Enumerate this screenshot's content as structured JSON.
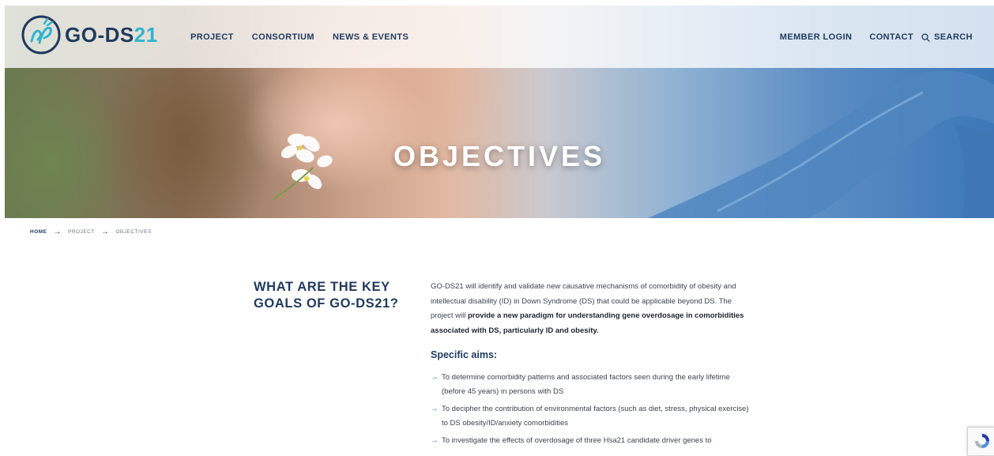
{
  "header": {
    "logo_text_main": "GO-DS",
    "logo_text_num": "21",
    "nav_left": [
      "PROJECT",
      "CONSORTIUM",
      "NEWS & EVENTS"
    ],
    "nav_right": [
      "MEMBER LOGIN",
      "CONTACT"
    ],
    "search_label": "SEARCH"
  },
  "hero": {
    "title": "OBJECTIVES"
  },
  "breadcrumb": {
    "home": "HOME",
    "project": "PROJECT",
    "current": "OBJECTIVES"
  },
  "content": {
    "heading": "WHAT ARE THE KEY GOALS OF GO-DS21?",
    "intro_plain": "GO-DS21 will identify and validate new causative mechanisms of comorbidity of obesity and intellectual disability (ID) in Down Syndrome (DS) that could be applicable beyond DS. The project will ",
    "intro_bold": "provide a new paradigm for understanding gene overdosage in comorbidities associated with DS, particularly ID and obesity.",
    "aims_title": "Specific aims:",
    "aims": [
      "To determine comorbidity patterns and associated factors seen during the early lifetime (before 45 years) in persons with DS",
      "To decipher the contribution of environmental factors (such as diet, stress, physical exercise) to DS obesity/ID/anxiety comorbidities",
      "To investigate the effects of overdosage of three Hsa21 candidate driver genes to"
    ]
  },
  "colors": {
    "navy": "#1f3a5f",
    "accent_cyan": "#2fb5cf",
    "arrow_blue": "#2a6fb8"
  },
  "icons": {
    "search": "search-icon",
    "breadcrumb_separator": "arrow-right-icon",
    "list_bullet": "arrow-right-icon",
    "captcha": "recaptcha-icon"
  }
}
